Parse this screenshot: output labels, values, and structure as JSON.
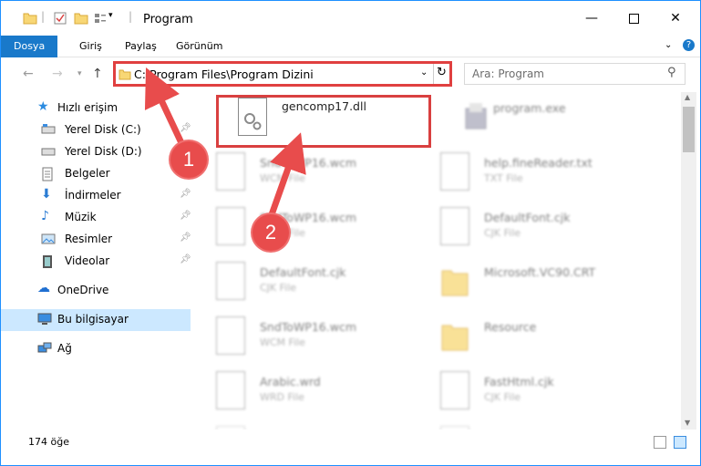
{
  "window": {
    "title": "Program",
    "minimize_icon": "minimize-icon",
    "maximize_icon": "maximize-icon",
    "close_icon": "close-icon"
  },
  "ribbon": {
    "tabs": [
      "Dosya",
      "Giriş",
      "Paylaş",
      "Görünüm"
    ]
  },
  "address": {
    "path": "C:\\Program Files\\Program Dizini",
    "search_placeholder": "Ara: Program"
  },
  "sidebar": {
    "items": [
      {
        "label": "Hızlı erişim",
        "icon": "star-icon"
      },
      {
        "label": "Yerel Disk (C:)",
        "icon": "drive-icon",
        "pinned": true
      },
      {
        "label": "Yerel Disk (D:)",
        "icon": "drive-icon"
      },
      {
        "label": "Belgeler",
        "icon": "documents-icon",
        "pinned": true
      },
      {
        "label": "İndirmeler",
        "icon": "download-icon",
        "pinned": true
      },
      {
        "label": "Müzik",
        "icon": "music-icon",
        "pinned": true
      },
      {
        "label": "Resimler",
        "icon": "pictures-icon",
        "pinned": true
      },
      {
        "label": "Videolar",
        "icon": "videos-icon",
        "pinned": true
      },
      {
        "label": "OneDrive",
        "icon": "cloud-icon"
      },
      {
        "label": "Bu bilgisayar",
        "icon": "computer-icon",
        "selected": true
      },
      {
        "label": "Ağ",
        "icon": "network-icon"
      }
    ]
  },
  "files": [
    {
      "name": "gencomp17.dll",
      "type": ""
    },
    {
      "name": "program.exe",
      "type": ""
    },
    {
      "name": "SndToWP16.wcm",
      "type": "WCM File"
    },
    {
      "name": "help.fineReader.txt",
      "type": "TXT File"
    },
    {
      "name": "SndToWP16.wcm",
      "type": "WCM File"
    },
    {
      "name": "DefaultFont.cjk",
      "type": "CJK File"
    },
    {
      "name": "DefaultFont.cjk",
      "type": "CJK File"
    },
    {
      "name": "Microsoft.VC90.CRT",
      "type": ""
    },
    {
      "name": "SndToWP16.wcm",
      "type": "WCM File"
    },
    {
      "name": "Resource",
      "type": ""
    },
    {
      "name": "Arabic.wrd",
      "type": "WRD File"
    },
    {
      "name": "FastHtml.cjk",
      "type": "CJK File"
    }
  ],
  "status": {
    "count": "174 öğe"
  },
  "callouts": [
    "1",
    "2"
  ],
  "colors": {
    "accent": "#1979ca",
    "highlight": "#d94040",
    "callout": "#e84c4c"
  }
}
